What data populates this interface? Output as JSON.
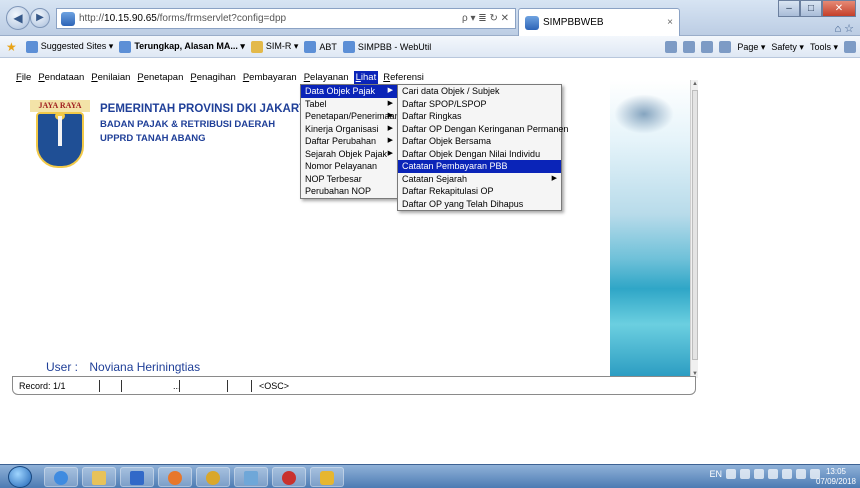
{
  "browser": {
    "url_prefix": "http://",
    "url_host": "10.15.90.65",
    "url_path": "/forms/frmservlet?config=dpp",
    "address_tools": "ρ ▾ ≣ ↻ ✕",
    "tab_title": "SIMPBBWEB",
    "tab_close": "×"
  },
  "favorites": [
    {
      "label": "Suggested Sites ▾",
      "bold": "",
      "icon": "star-icon"
    },
    {
      "label": "Terungkap, Alasan MA... ▾",
      "bold": "yes",
      "icon": "ie-page-icon"
    },
    {
      "label": "SIM-R ▾",
      "bold": "",
      "icon": "mail-icon"
    },
    {
      "label": "ABT",
      "bold": "",
      "icon": "ie-page-icon"
    },
    {
      "label": "SIMPBB - WebUtil",
      "bold": "",
      "icon": "ie-page-icon"
    }
  ],
  "commandbar": {
    "page": "Page ▾",
    "safety": "Safety ▾",
    "tools": "Tools ▾"
  },
  "menubar": [
    "File",
    "Pendataan",
    "Penilaian",
    "Penetapan",
    "Penagihan",
    "Pembayaran",
    "Pelayanan",
    "Lihat",
    "Referensi"
  ],
  "org": {
    "line1": "PEMERINTAH PROVINSI DKI JAKARTA",
    "line2": "BADAN PAJAK & RETRIBUSI DAERAH",
    "line3": "UPPRD TANAH ABANG",
    "logo_text": "JAYA RAYA"
  },
  "lihat_menu": [
    {
      "label": "Data Objek Pajak",
      "sub": true
    },
    {
      "label": "Tabel",
      "sub": true
    },
    {
      "label": "Penetapan/Penerimaan",
      "sub": true
    },
    {
      "label": "Kinerja Organisasi",
      "sub": true
    },
    {
      "label": "Daftar Perubahan",
      "sub": true
    },
    {
      "label": "Sejarah Objek Pajak",
      "sub": true
    },
    {
      "label": "Nomor Pelayanan",
      "sub": false
    },
    {
      "label": "NOP Terbesar",
      "sub": false
    },
    {
      "label": "Perubahan NOP",
      "sub": false
    }
  ],
  "submenu": [
    {
      "label": "Cari data Objek / Subjek",
      "sub": false
    },
    {
      "label": "Daftar SPOP/LSPOP",
      "sub": false
    },
    {
      "label": "Daftar Ringkas",
      "sub": false
    },
    {
      "label": "Daftar OP Dengan Keringanan Permanen",
      "sub": false
    },
    {
      "label": "Daftar Objek Bersama",
      "sub": false
    },
    {
      "label": "Daftar Objek Dengan Nilai Individu",
      "sub": false
    },
    {
      "label": "Catatan Pembayaran PBB",
      "sub": false
    },
    {
      "label": "Catatan Sejarah",
      "sub": true
    },
    {
      "label": "Daftar Rekapitulasi OP",
      "sub": false
    },
    {
      "label": "Daftar OP yang Telah Dihapus",
      "sub": false
    }
  ],
  "user": {
    "label": "User :",
    "name": "Noviana Heriningtias"
  },
  "status": {
    "record": "Record: 1/1",
    "dots": "...",
    "osc": "<OSC>"
  },
  "tray": {
    "lang": "EN",
    "time": "13:05",
    "date": "07/09/2018"
  },
  "colors": {
    "highlight": "#0a24b8",
    "org_text": "#1f3f98"
  }
}
